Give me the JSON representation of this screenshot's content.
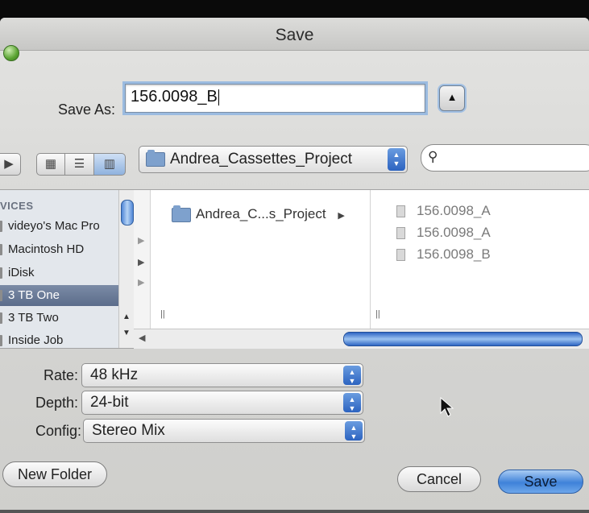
{
  "window": {
    "title": "Save"
  },
  "save_as": {
    "label": "Save As:",
    "value": "156.0098_B"
  },
  "toolbar": {
    "location": "Andrea_Cassettes_Project",
    "search_placeholder": ""
  },
  "sidebar": {
    "section_header": "VICES",
    "items": [
      {
        "label": "videyo's Mac Pro"
      },
      {
        "label": "Macintosh HD"
      },
      {
        "label": "iDisk"
      },
      {
        "label": "3 TB One",
        "selected": true
      },
      {
        "label": "3 TB Two"
      },
      {
        "label": "Inside Job"
      }
    ]
  },
  "columns": {
    "col1_item": "Andrea_C...s_Project",
    "files": [
      "156.0098_A",
      "156.0098_A",
      "156.0098_B"
    ]
  },
  "options": {
    "rate": {
      "label": "Rate:",
      "value": "48 kHz"
    },
    "depth": {
      "label": "Depth:",
      "value": "24-bit"
    },
    "config": {
      "label": "Config:",
      "value": "Stereo Mix"
    }
  },
  "buttons": {
    "new_folder": "New Folder",
    "cancel": "Cancel",
    "save": "Save"
  }
}
